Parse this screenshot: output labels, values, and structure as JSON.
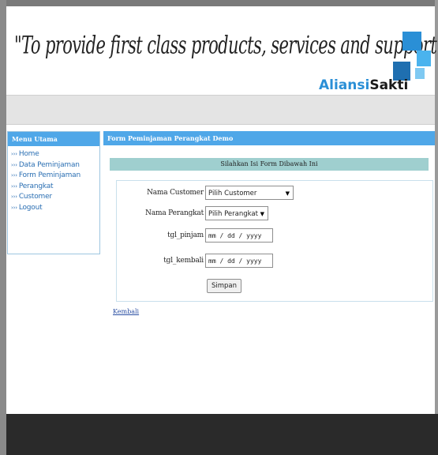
{
  "header": {
    "slogan": "\"To provide first class products, services and support\"",
    "brand_part1": "Aliansi",
    "brand_part2": "Sakti",
    "logo_icon": "aliansisakti-logo-icon",
    "colors": {
      "brand_blue": "#2a8fd6",
      "brand_dark": "#1a1a1a"
    }
  },
  "sidebar": {
    "title": "Menu Utama",
    "items": [
      {
        "label": "Home"
      },
      {
        "label": "Data Peminjaman"
      },
      {
        "label": "Form Peminjaman"
      },
      {
        "label": "Perangkat"
      },
      {
        "label": "Customer"
      },
      {
        "label": "Logout"
      }
    ],
    "item_prefix": "›››"
  },
  "content": {
    "title": "Form Peminjaman Perangkat Demo",
    "notice": "Silahkan Isi Form Dibawah Ini",
    "form": {
      "customer_label": "Nama Customer",
      "customer_value": "Pilih Customer",
      "perangkat_label": "Nama Perangkat",
      "perangkat_value": "Pilih Perangkat",
      "pinjam_label": "tgl_pinjam",
      "pinjam_placeholder": "mm / dd / yyyy",
      "kembali_label": "tgl_kembali",
      "kembali_placeholder": "mm / dd / yyyy",
      "submit_label": "Simpan"
    },
    "back_link": "Kembali"
  },
  "colors": {
    "panel_header": "#4fa7e8",
    "notice_bg": "#9fcfcf",
    "link": "#2b6fb3",
    "footer": "#2a2a2a"
  }
}
